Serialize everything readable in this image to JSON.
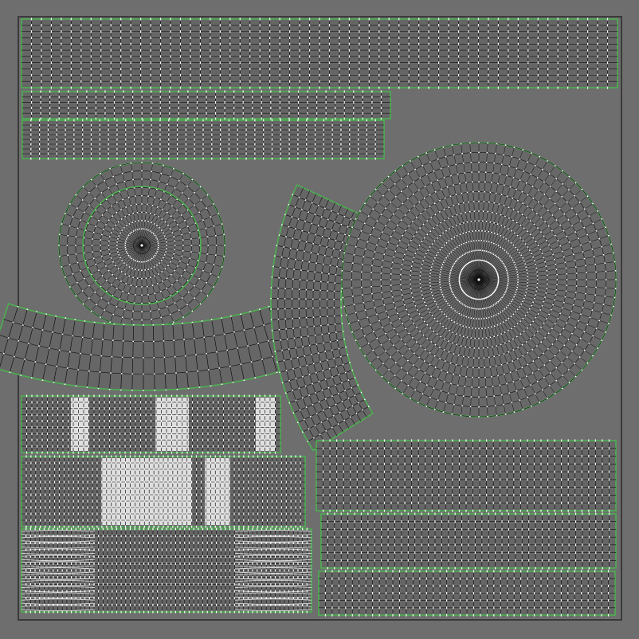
{
  "editor": {
    "view": "uv-editor",
    "background_color": "#6e6e6e",
    "border_color": "#3a3a3a",
    "edge_color": "#111111",
    "seam_color": "#4caf50",
    "vertex_color": "#ffffff"
  },
  "uv_islands": [
    {
      "name": "uv-island-strip-top",
      "shape": "strip",
      "rows": 11,
      "cols": 60
    },
    {
      "name": "uv-island-strip-2",
      "shape": "strip",
      "rows": 5,
      "cols": 40
    },
    {
      "name": "uv-island-strip-3",
      "shape": "strip",
      "rows": 8,
      "cols": 42
    },
    {
      "name": "uv-island-disc-small",
      "shape": "disc",
      "rings": 10,
      "spokes": 48
    },
    {
      "name": "uv-island-arc-lower",
      "shape": "arc",
      "rows": 4,
      "cols": 28
    },
    {
      "name": "uv-island-arc-vertical",
      "shape": "arc",
      "rows": 10,
      "cols": 26
    },
    {
      "name": "uv-island-disc-large",
      "shape": "disc",
      "rings": 14,
      "spokes": 96
    },
    {
      "name": "uv-island-strip-white-1",
      "shape": "strip",
      "rows": 9,
      "cols": 50
    },
    {
      "name": "uv-island-strip-white-2",
      "shape": "strip",
      "rows": 11,
      "cols": 60
    },
    {
      "name": "uv-island-strip-dense",
      "shape": "strip",
      "rows": 12,
      "cols": 64
    },
    {
      "name": "uv-island-strip-right-1",
      "shape": "strip",
      "rows": 9,
      "cols": 44
    },
    {
      "name": "uv-island-strip-right-2",
      "shape": "strip",
      "rows": 7,
      "cols": 44
    },
    {
      "name": "uv-island-strip-right-3",
      "shape": "strip",
      "rows": 6,
      "cols": 44
    }
  ]
}
